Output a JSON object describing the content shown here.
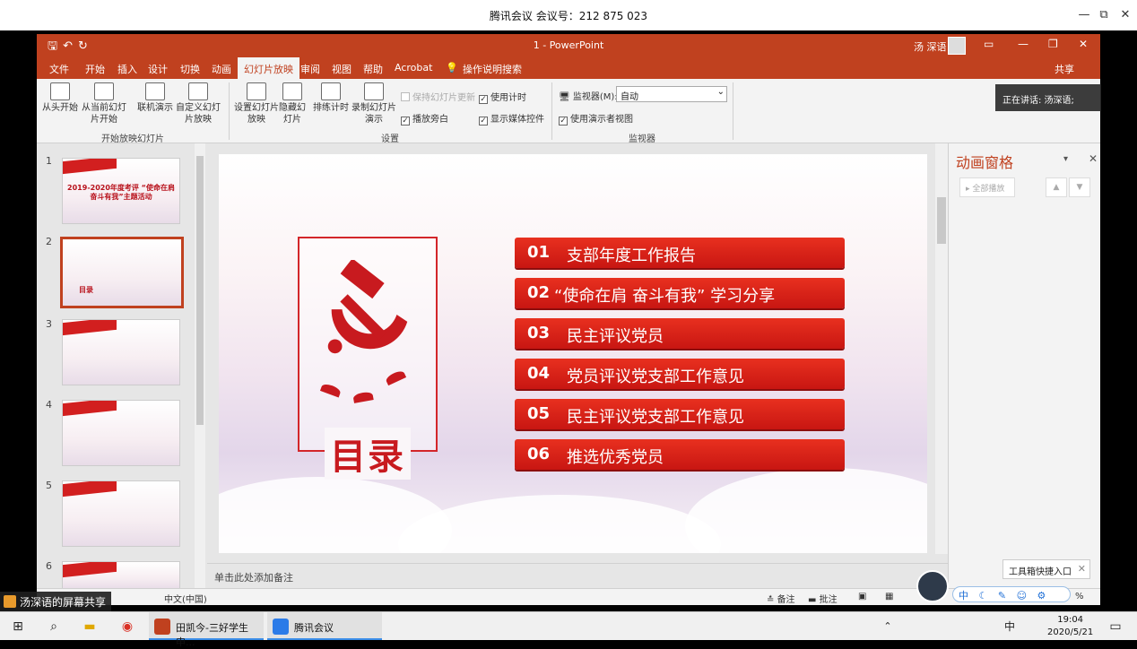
{
  "meeting": {
    "title": "腾讯会议 会议号：212 875 023",
    "min": "—",
    "restore": "⧉",
    "close": "✕"
  },
  "ppt": {
    "doc_title": "1 - PowerPoint",
    "user": "汤 深语",
    "share": "共享",
    "tabs": [
      "文件",
      "开始",
      "插入",
      "设计",
      "切换",
      "动画",
      "幻灯片放映",
      "审阅",
      "视图",
      "帮助",
      "Acrobat",
      "操作说明搜索"
    ],
    "active_tab": "幻灯片放映",
    "ribbon": {
      "from_start": "从头开始",
      "from_current": "从当前幻灯片开始",
      "online": "联机演示",
      "custom": "自定义幻灯片放映",
      "group1": "开始放映幻灯片",
      "setup": "设置幻灯片放映",
      "hide": "隐藏幻灯片",
      "rehearse": "排练计时",
      "record": "录制幻灯片演示",
      "keep_updated": "保持幻灯片更新",
      "use_timing": "使用计时",
      "play_narration": "播放旁白",
      "show_media": "显示媒体控件",
      "group2": "设置",
      "monitor_label": "监视器(M):",
      "monitor_value": "自动",
      "presenter_view": "使用演示者视图",
      "group3": "监视器"
    },
    "thumbs": [
      {
        "num": "1",
        "title": "2019-2020年度考评 “使命在肩 奋斗有我”主题活动"
      },
      {
        "num": "2",
        "title": "目录"
      },
      {
        "num": "3",
        "title": ""
      },
      {
        "num": "4",
        "title": ""
      },
      {
        "num": "5",
        "title": ""
      },
      {
        "num": "6",
        "title": ""
      }
    ],
    "slide": {
      "heading": "目录",
      "items": [
        {
          "num": "01",
          "text": "支部年度工作报告"
        },
        {
          "num": "02",
          "text": "“使命在肩 奋斗有我” 学习分享"
        },
        {
          "num": "03",
          "text": "民主评议党员"
        },
        {
          "num": "04",
          "text": "党员评议党支部工作意见"
        },
        {
          "num": "05",
          "text": "民主评议党支部工作意见"
        },
        {
          "num": "06",
          "text": "推选优秀党员"
        }
      ]
    },
    "notes_placeholder": "单击此处添加备注",
    "anim_pane": {
      "title": "动画窗格",
      "play_all": "全部播放"
    },
    "status": {
      "lang": "中文(中国)",
      "notes": "备注",
      "comments": "批注",
      "zoom": "%"
    }
  },
  "overlay": {
    "speaking": "正在讲话: 汤深语;",
    "share_label": "汤深语的屏幕共享",
    "toolbox": "工具箱快捷入口"
  },
  "taskbar": {
    "app1": "田凯今-三好学生申...",
    "app2": "腾讯会议",
    "ime": "中",
    "time": "19:04",
    "date": "2020/5/21"
  },
  "colors": {
    "ppt_accent": "#c0411f",
    "slide_red": "#c81a1f"
  }
}
